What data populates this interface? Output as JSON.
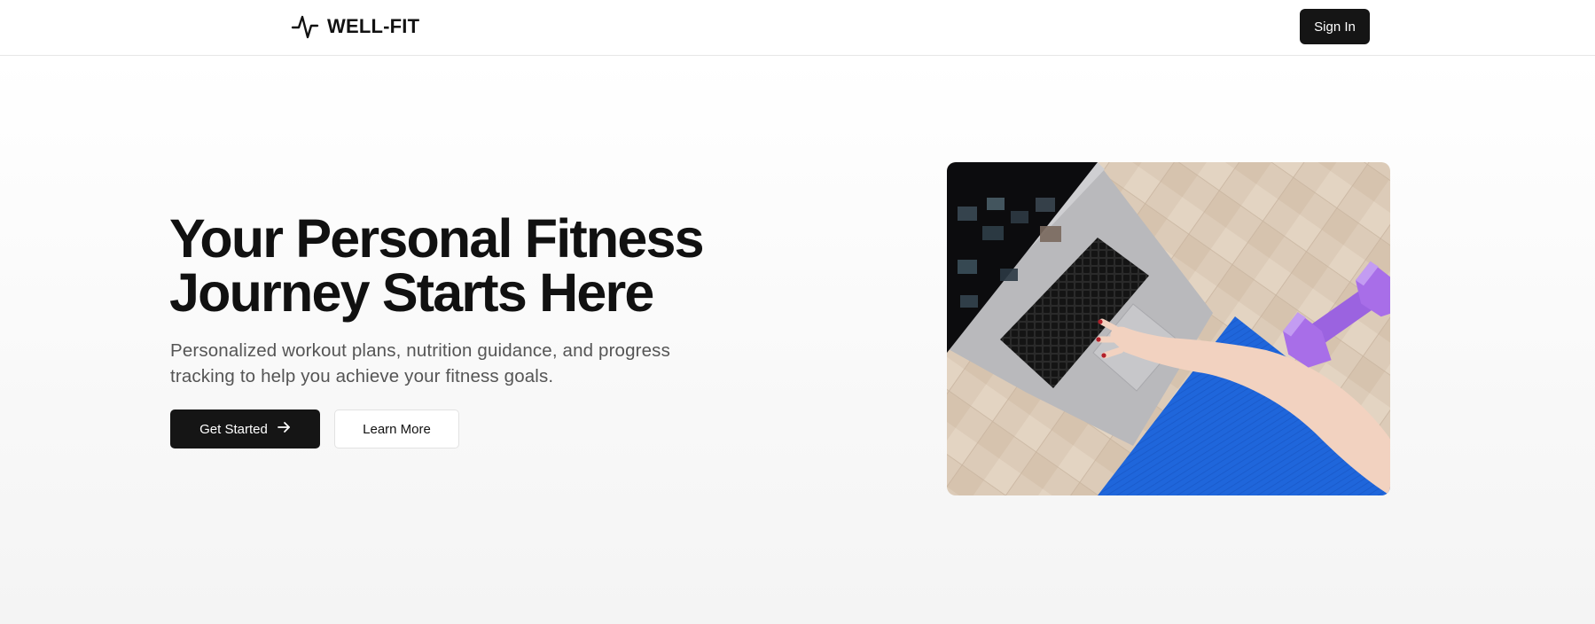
{
  "header": {
    "brand_name": "WELL-FIT",
    "brand_icon": "activity-pulse-icon",
    "signin_label": "Sign In"
  },
  "hero": {
    "title_line1": "Your Personal Fitness",
    "title_line2": "Journey Starts Here",
    "subtitle_line1": "Personalized workout plans, nutrition guidance, and progress",
    "subtitle_line2": "tracking to help you achieve your fitness goals.",
    "primary_cta_label": "Get Started",
    "primary_cta_icon": "arrow-right-icon",
    "secondary_cta_label": "Learn More",
    "image_alt": "Woman using laptop on a yoga mat next to a purple dumbbell"
  },
  "colors": {
    "primary": "#151515",
    "text": "#111111",
    "muted_text": "#555555",
    "mat_blue": "#1e63d8",
    "dumbbell_purple": "#a86ee8"
  }
}
